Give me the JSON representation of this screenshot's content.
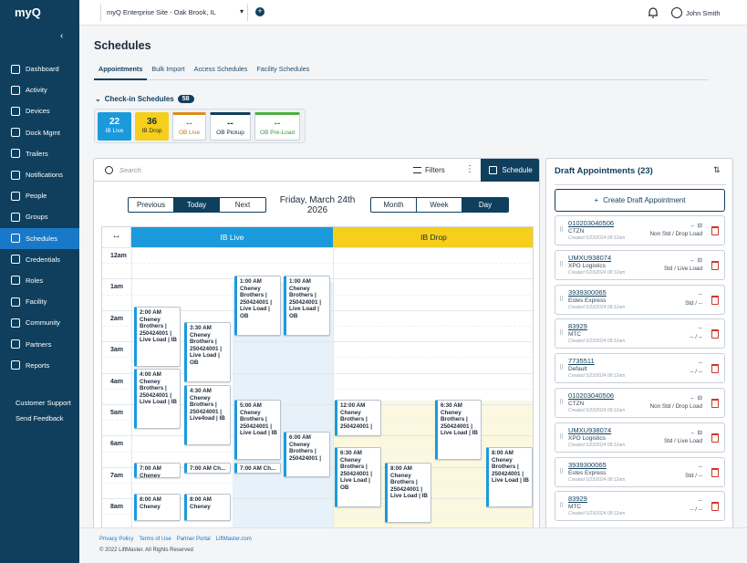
{
  "header": {
    "logo": "myQ",
    "site": "myQ Enterprise Site - Oak Brook, IL",
    "user": "John Smith"
  },
  "sidebar": {
    "items": [
      {
        "label": "Dashboard",
        "icon": "dashboard-icon"
      },
      {
        "label": "Activity",
        "icon": "activity-icon"
      },
      {
        "label": "Devices",
        "icon": "devices-icon"
      },
      {
        "label": "Dock Mgmt",
        "icon": "dock-icon"
      },
      {
        "label": "Trailers",
        "icon": "trailer-icon"
      },
      {
        "label": "Notifications",
        "icon": "mail-icon"
      },
      {
        "label": "People",
        "icon": "person-icon"
      },
      {
        "label": "Groups",
        "icon": "groups-icon"
      },
      {
        "label": "Schedules",
        "icon": "calendar-icon"
      },
      {
        "label": "Credentials",
        "icon": "key-icon"
      },
      {
        "label": "Roles",
        "icon": "roles-icon"
      },
      {
        "label": "Facility",
        "icon": "facility-icon"
      },
      {
        "label": "Community",
        "icon": "community-icon"
      },
      {
        "label": "Partners",
        "icon": "handshake-icon"
      },
      {
        "label": "Reports",
        "icon": "reports-icon"
      }
    ],
    "support": "Customer Support",
    "feedback": "Send Feedback"
  },
  "page": {
    "title": "Schedules",
    "tabs": [
      "Appointments",
      "Bulk Import",
      "Access Schedules",
      "Facility Schedules"
    ],
    "checkin_label": "Check-in Schedules",
    "checkin_count": "58",
    "cards": [
      {
        "num": "22",
        "label": "IB Live",
        "bg": "#1b9adb",
        "fg": "#ffffff"
      },
      {
        "num": "36",
        "label": "IB Drop",
        "bg": "#f5cf1b",
        "fg": "#1e2a3a"
      },
      {
        "num": "--",
        "label": "OB Live",
        "bg": "#ffffff",
        "fg": "#c9731a",
        "bar": "#e08a1e"
      },
      {
        "num": "--",
        "label": "OB Pickup",
        "bg": "#ffffff",
        "fg": "#1e2a3a",
        "bar": "#0f3f5d"
      },
      {
        "num": "--",
        "label": "OB Pre-Load",
        "bg": "#ffffff",
        "fg": "#3a9a3a",
        "bar": "#4caf3e"
      }
    ]
  },
  "calendar": {
    "search_placeholder": "Search",
    "filters": "Filters",
    "schedule_button": "Schedule",
    "previous": "Previous",
    "today": "Today",
    "next": "Next",
    "date_line1": "Friday, March 24th",
    "date_line2": "2026",
    "month": "Month",
    "week": "Week",
    "day": "Day",
    "col_live": "IB Live",
    "col_drop": "IB Drop",
    "hours": [
      "12am",
      "1am",
      "2am",
      "3am",
      "4am",
      "5am",
      "6am",
      "7am",
      "8am"
    ],
    "appointments": [
      {
        "id": "a1",
        "lines": [
          "1:00 AM",
          "Cheney",
          "Brothers |",
          "250424001 |",
          "Live Load | OB"
        ]
      },
      {
        "id": "a2",
        "lines": [
          "1:00 AM",
          "Cheney",
          "Brothers |",
          "250424001 |",
          "Live Load | OB"
        ]
      },
      {
        "id": "a3",
        "lines": [
          "2:00 AM",
          "Cheney",
          "Brothers |",
          "250424001 |",
          "Live Load | IB"
        ]
      },
      {
        "id": "a4",
        "lines": [
          "3:30 AM",
          "Cheney",
          "Brothers |",
          "250424001 |",
          "Live Load | OB"
        ]
      },
      {
        "id": "a5",
        "lines": [
          "4:00 AM",
          "Cheney",
          "Brothers |",
          "250424001 |",
          "Live Load | IB"
        ]
      },
      {
        "id": "a6",
        "lines": [
          "4:30 AM",
          "Cheney",
          "Brothers |",
          "250424001 |",
          "Live4oad | IB"
        ]
      },
      {
        "id": "a7",
        "lines": [
          "5:00 AM",
          "Cheney",
          "Brothers |",
          "250424001 |",
          "Live Load | IB"
        ]
      },
      {
        "id": "a8",
        "lines": [
          "6:00 AM",
          "Cheney",
          "Brothers |",
          "250424001 |"
        ]
      },
      {
        "id": "a9",
        "lines": [
          "7:00 AM",
          "Cheney Broth..."
        ]
      },
      {
        "id": "a10",
        "lines": [
          "7:00 AM Ch..."
        ]
      },
      {
        "id": "a11",
        "lines": [
          "7:00 AM Ch..."
        ]
      },
      {
        "id": "a12",
        "lines": [
          "8:00 AM",
          "Cheney"
        ]
      },
      {
        "id": "a13",
        "lines": [
          "8:00 AM",
          "Cheney"
        ]
      },
      {
        "id": "d1",
        "lines": [
          "12:00 AM",
          "Cheney",
          "Brothers |",
          "250424001 |"
        ]
      },
      {
        "id": "d2",
        "lines": [
          "6:30 AM",
          "Cheney",
          "Brothers |",
          "250424001 |",
          "Live Load | OB"
        ]
      },
      {
        "id": "d3",
        "lines": [
          "6:30 AM",
          "Cheney",
          "Brothers |",
          "250424001 |",
          "Live Load | IB"
        ]
      },
      {
        "id": "d4",
        "lines": [
          "8:00 AM",
          "Cheney",
          "Brothers |",
          "250424001 |",
          "Live Load | IB"
        ]
      },
      {
        "id": "d5",
        "lines": [
          "8:00 AM",
          "Cheney",
          "Brothers |",
          "250424001 |",
          "Live Load | IB"
        ]
      }
    ]
  },
  "drafts": {
    "title": "Draft Appointments (23)",
    "create": "Create Draft Appointment",
    "items": [
      {
        "id": "010203040506",
        "carrier": "CTZN",
        "created": "Created 5/23/2024 08:12am",
        "tag": "← ⊟",
        "load": "Non Std / Drop Load"
      },
      {
        "id": "UMXU938074",
        "carrier": "XPO Logistics",
        "created": "Created 5/23/2024 08:12am",
        "tag": "← ⊟",
        "load": "Std / Live Load"
      },
      {
        "id": "3939300065",
        "carrier": "Estes Express",
        "created": "Created 5/23/2024 08:12am",
        "tag": "--",
        "load": "Std / --"
      },
      {
        "id": "83929",
        "carrier": "MTC",
        "created": "Created 5/23/2024 08:12am",
        "tag": "--",
        "load": "-- / --"
      },
      {
        "id": "7735511",
        "carrier": "Default",
        "created": "Created 5/23/2024 08:12am",
        "tag": "--",
        "load": "-- / --"
      },
      {
        "id": "010203040506",
        "carrier": "CTZN",
        "created": "Created 5/23/2024 08:12am",
        "tag": "← ⊟",
        "load": "Non Std / Drop Load"
      },
      {
        "id": "UMXU938074",
        "carrier": "XPO Logistics",
        "created": "Created 5/23/2024 08:12am",
        "tag": "← ⊟",
        "load": "Std / Live Load"
      },
      {
        "id": "3939300065",
        "carrier": "Estes Express",
        "created": "Created 5/23/2024 08:12am",
        "tag": "--",
        "load": "Std / --"
      },
      {
        "id": "83929",
        "carrier": "MTC",
        "created": "Created 5/23/2024 08:12am",
        "tag": "--",
        "load": "-- / --"
      }
    ]
  },
  "footer": {
    "links": [
      "Privacy Policy",
      "Terms of Use",
      "Partner Portal",
      "LiftMaster.com"
    ],
    "copyright": "© 2022 LiftMaster. All Rights Reserved"
  }
}
